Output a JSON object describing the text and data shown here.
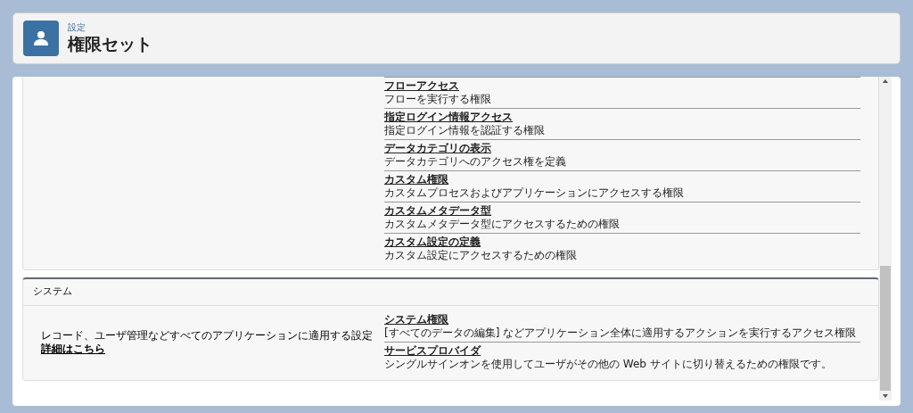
{
  "header": {
    "breadcrumb": "設定",
    "title": "権限セット"
  },
  "sections": [
    {
      "items": [
        {
          "title": "フローアクセス",
          "description": "フローを実行する権限"
        },
        {
          "title": "指定ログイン情報アクセス",
          "description": "指定ログイン情報を認証する権限"
        },
        {
          "title": "データカテゴリの表示",
          "description": "データカテゴリへのアクセス権を定義"
        },
        {
          "title": "カスタム権限",
          "description": "カスタムプロセスおよびアプリケーションにアクセスする権限"
        },
        {
          "title": "カスタムメタデータ型",
          "description": "カスタムメタデータ型にアクセスするための権限"
        },
        {
          "title": "カスタム設定の定義",
          "description": "カスタム設定にアクセスするための権限"
        }
      ]
    },
    {
      "heading": "システム",
      "summary": "レコード、ユーザ管理などすべてのアプリケーションに適用する設定",
      "link": "詳細はこちら",
      "items": [
        {
          "title": "システム権限",
          "description": "[すべてのデータの編集] などアプリケーション全体に適用するアクションを実行するアクセス権限"
        },
        {
          "title": "サービスプロバイダ",
          "description": "シングルサインオンを使用してユーザがその他の Web サイトに切り替えるための権限です。"
        }
      ]
    }
  ]
}
